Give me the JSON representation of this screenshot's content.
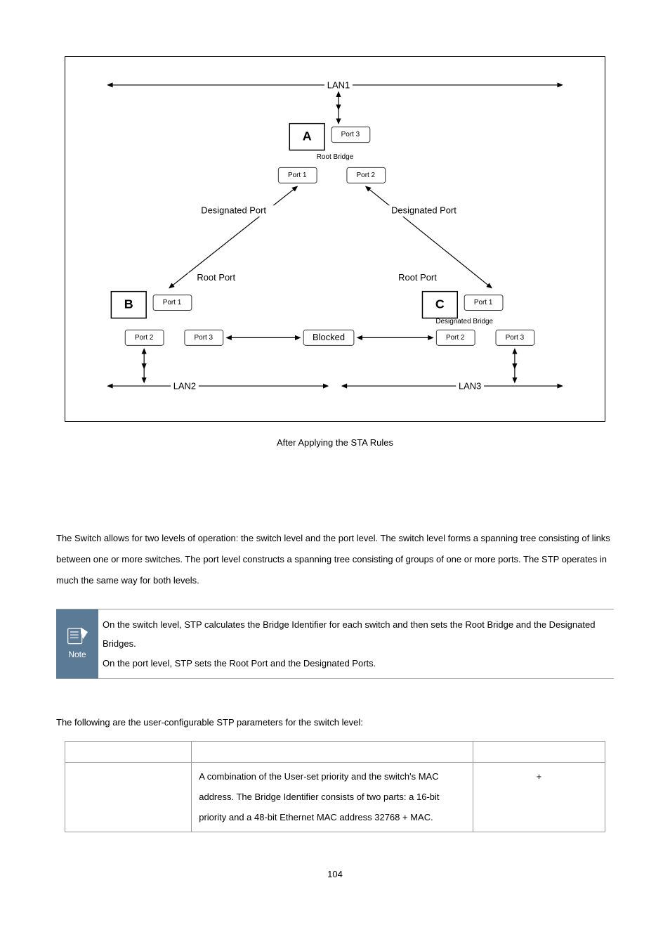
{
  "diagram": {
    "lan1": "LAN1",
    "lan2": "LAN2",
    "lan3": "LAN3",
    "switch_a": "A",
    "switch_b": "B",
    "switch_c": "C",
    "port1": "Port 1",
    "port2": "Port 2",
    "port3": "Port 3",
    "root_bridge": "Root Bridge",
    "designated_bridge": "Designated Bridge",
    "designated_port": "Designated Port",
    "root_port": "Root Port",
    "blocked": "Blocked"
  },
  "caption": "After Applying the STA Rules",
  "body_paragraph": "The Switch allows for two levels of operation: the switch level and the port level. The switch level forms a spanning tree consisting of links between one or more switches. The port level constructs a spanning tree consisting of groups of one or more ports. The STP operates in much the same way for both levels.",
  "note": {
    "label": "Note",
    "line1": "On the switch level, STP calculates the Bridge Identifier for each switch and then sets the Root Bridge and the Designated Bridges.",
    "line2": "On the port level, STP sets the Root Port and the Designated Ports."
  },
  "pre_table_text": "The following are the user-configurable STP parameters for the switch level:",
  "table": {
    "header_col1": "",
    "header_col2": "",
    "header_col3": "",
    "row1": {
      "col1": "",
      "col2": "A combination of the User-set priority and the switch's MAC address.\nThe Bridge Identifier consists of two parts: a 16-bit priority and a 48-bit Ethernet MAC address 32768 + MAC.",
      "col3": "+"
    }
  },
  "page_number": "104"
}
